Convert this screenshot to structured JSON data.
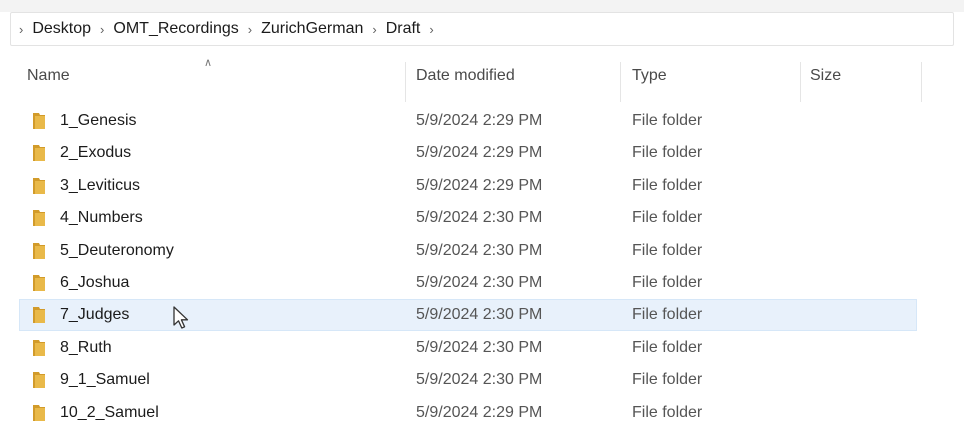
{
  "breadcrumb": {
    "items": [
      "Desktop",
      "OMT_Recordings",
      "ZurichGerman",
      "Draft"
    ]
  },
  "columns": {
    "name": "Name",
    "date": "Date modified",
    "type": "Type",
    "size": "Size"
  },
  "rows": [
    {
      "name": "1_Genesis",
      "date": "5/9/2024 2:29 PM",
      "type": "File folder",
      "size": ""
    },
    {
      "name": "2_Exodus",
      "date": "5/9/2024 2:29 PM",
      "type": "File folder",
      "size": ""
    },
    {
      "name": "3_Leviticus",
      "date": "5/9/2024 2:29 PM",
      "type": "File folder",
      "size": ""
    },
    {
      "name": "4_Numbers",
      "date": "5/9/2024 2:30 PM",
      "type": "File folder",
      "size": ""
    },
    {
      "name": "5_Deuteronomy",
      "date": "5/9/2024 2:30 PM",
      "type": "File folder",
      "size": ""
    },
    {
      "name": "6_Joshua",
      "date": "5/9/2024 2:30 PM",
      "type": "File folder",
      "size": ""
    },
    {
      "name": "7_Judges",
      "date": "5/9/2024 2:30 PM",
      "type": "File folder",
      "size": "",
      "selected": true
    },
    {
      "name": "8_Ruth",
      "date": "5/9/2024 2:30 PM",
      "type": "File folder",
      "size": ""
    },
    {
      "name": "9_1_Samuel",
      "date": "5/9/2024 2:30 PM",
      "type": "File folder",
      "size": ""
    },
    {
      "name": "10_2_Samuel",
      "date": "5/9/2024 2:29 PM",
      "type": "File folder",
      "size": ""
    }
  ],
  "icons": {
    "folder": "folder-icon",
    "separator": "chevron-right-icon",
    "sort": "sort-up-icon",
    "cursor": "mouse-pointer-icon"
  },
  "colors": {
    "folder": "#e9b949",
    "folder_dark": "#d29b2a",
    "selection": "#e8f1fb"
  }
}
